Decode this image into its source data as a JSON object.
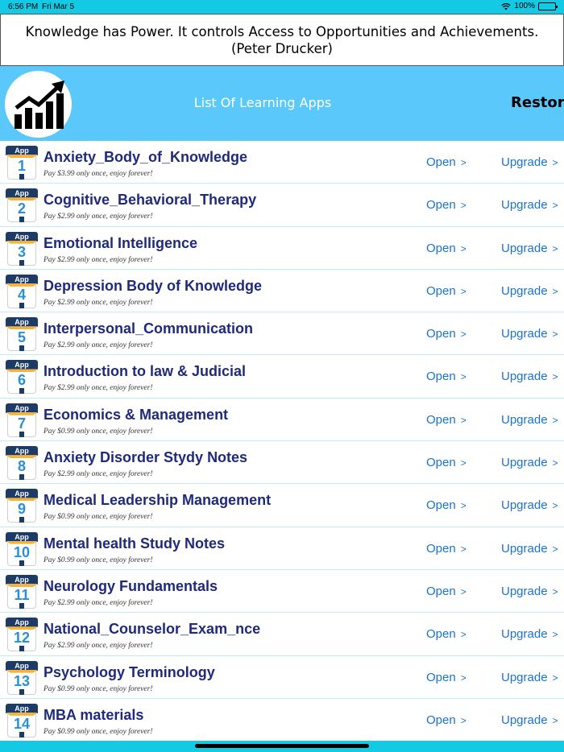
{
  "status": {
    "time": "6:56 PM",
    "date": "Fri Mar 5",
    "battery": "100%",
    "wifi_icon": "wifi-icon",
    "battery_icon": "battery-icon"
  },
  "quote": {
    "line1": "Knowledge has Power. It controls Access to Opportunities and Achievements.",
    "line2": "(Peter Drucker)"
  },
  "header": {
    "title": "List Of Learning Apps",
    "restore": "Restore",
    "logo_icon": "growth-chart-icon"
  },
  "colors": {
    "status_bar": "#14c9e4",
    "header": "#5ac8fa",
    "app_name": "#1f2a7a",
    "link": "#1a73c9"
  },
  "apps": [
    {
      "num": "1",
      "badge": "App",
      "name": "Anxiety_Body_of_Knowledge",
      "price": "Pay $3.99 only once, enjoy forever!",
      "open": "Open",
      "upgrade": "Upgrade"
    },
    {
      "num": "2",
      "badge": "App",
      "name": "Cognitive_Behavioral_Therapy",
      "price": "Pay $2.99 only once, enjoy forever!",
      "open": "Open",
      "upgrade": "Upgrade"
    },
    {
      "num": "3",
      "badge": "App",
      "name": "Emotional Intelligence",
      "price": "Pay $2.99 only once, enjoy forever!",
      "open": "Open",
      "upgrade": "Upgrade"
    },
    {
      "num": "4",
      "badge": "App",
      "name": "Depression Body of Knowledge",
      "price": "Pay $2.99 only once, enjoy forever!",
      "open": "Open",
      "upgrade": "Upgrade"
    },
    {
      "num": "5",
      "badge": "App",
      "name": "Interpersonal_Communication",
      "price": "Pay $2.99 only once, enjoy forever!",
      "open": "Open",
      "upgrade": "Upgrade"
    },
    {
      "num": "6",
      "badge": "App",
      "name": "Introduction to law & Judicial",
      "price": "Pay $2.99 only once, enjoy forever!",
      "open": "Open",
      "upgrade": "Upgrade"
    },
    {
      "num": "7",
      "badge": "App",
      "name": "Economics & Management",
      "price": "Pay $0.99 only once, enjoy forever!",
      "open": "Open",
      "upgrade": "Upgrade"
    },
    {
      "num": "8",
      "badge": "App",
      "name": "Anxiety Disorder Stydy Notes",
      "price": "Pay $2.99 only once, enjoy forever!",
      "open": "Open",
      "upgrade": "Upgrade"
    },
    {
      "num": "9",
      "badge": "App",
      "name": "Medical Leadership Management",
      "price": "Pay $0.99 only once, enjoy forever!",
      "open": "Open",
      "upgrade": "Upgrade"
    },
    {
      "num": "10",
      "badge": "App",
      "name": "Mental health Study Notes",
      "price": "Pay $0.99 only once, enjoy forever!",
      "open": "Open",
      "upgrade": "Upgrade"
    },
    {
      "num": "11",
      "badge": "App",
      "name": "Neurology Fundamentals",
      "price": "Pay $2.99 only once, enjoy forever!",
      "open": "Open",
      "upgrade": "Upgrade"
    },
    {
      "num": "12",
      "badge": "App",
      "name": "National_Counselor_Exam_nce",
      "price": "Pay $2.99 only once, enjoy forever!",
      "open": "Open",
      "upgrade": "Upgrade"
    },
    {
      "num": "13",
      "badge": "App",
      "name": "Psychology Terminology",
      "price": "Pay $0.99 only once, enjoy forever!",
      "open": "Open",
      "upgrade": "Upgrade"
    },
    {
      "num": "14",
      "badge": "App",
      "name": "MBA materials",
      "price": "Pay $0.99 only once, enjoy forever!",
      "open": "Open",
      "upgrade": "Upgrade"
    }
  ]
}
